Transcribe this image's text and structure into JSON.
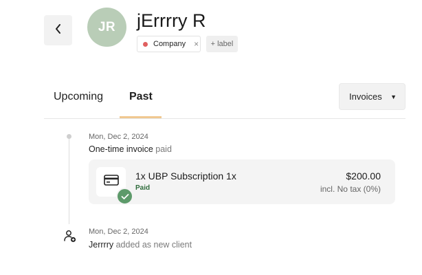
{
  "header": {
    "avatar_initials": "JR",
    "client_name": "jErrrry R",
    "label_chip": {
      "text": "Company",
      "remove_symbol": "×",
      "dot_color": "#e06060"
    },
    "add_label": "+ label"
  },
  "tabs": [
    {
      "label": "Upcoming",
      "active": false
    },
    {
      "label": "Past",
      "active": true
    }
  ],
  "filter": {
    "selected": "Invoices",
    "caret": "▼"
  },
  "timeline": {
    "events": [
      {
        "date": "Mon, Dec 2, 2024",
        "title": "One-time invoice",
        "suffix": "paid",
        "card": {
          "title": "1x UBP Subscription 1x",
          "status": "Paid",
          "amount": "$200.00",
          "tax": "incl. No tax (0%)"
        }
      },
      {
        "date": "Mon, Dec 2, 2024",
        "title": "Jerrrry",
        "suffix": "added as new client"
      }
    ]
  },
  "colors": {
    "avatar_bg": "#b9cdb7",
    "tab_underline": "#f0c890",
    "paid_badge": "#5d9a6a",
    "paid_text": "#2e6b3b"
  }
}
